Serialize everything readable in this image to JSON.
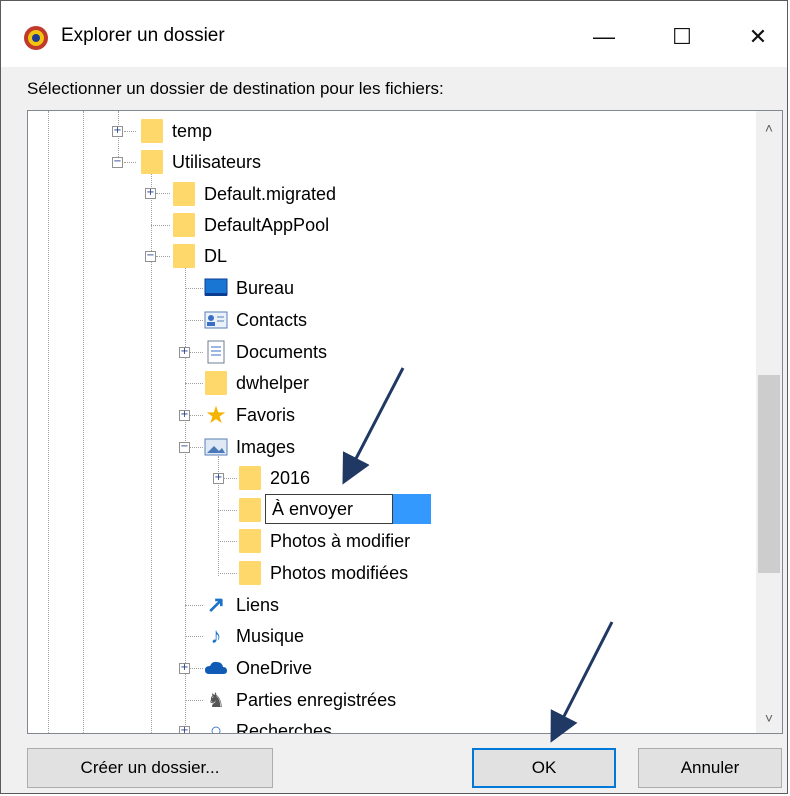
{
  "window": {
    "title": "Explorer un dossier"
  },
  "titlebar": {
    "minimize": "—",
    "maximize": "☐",
    "close": "✕"
  },
  "prompt": "Sélectionner un dossier de destination pour les fichiers:",
  "tree": {
    "items": [
      {
        "label": "temp",
        "icon": "folder-icon"
      },
      {
        "label": "Utilisateurs",
        "icon": "folder-icon"
      },
      {
        "label": "Default.migrated",
        "icon": "folder-icon"
      },
      {
        "label": "DefaultAppPool",
        "icon": "folder-icon"
      },
      {
        "label": "DL",
        "icon": "folder-icon"
      },
      {
        "label": "Bureau",
        "icon": "desktop-icon"
      },
      {
        "label": "Contacts",
        "icon": "contacts-icon"
      },
      {
        "label": "Documents",
        "icon": "documents-icon"
      },
      {
        "label": "dwhelper",
        "icon": "folder-icon"
      },
      {
        "label": "Favoris",
        "icon": "star-icon"
      },
      {
        "label": "Images",
        "icon": "images-icon"
      },
      {
        "label": "2016",
        "icon": "folder-icon"
      },
      {
        "label": "À envoyer",
        "icon": "folder-icon"
      },
      {
        "label": "Photos à modifier",
        "icon": "folder-icon"
      },
      {
        "label": "Photos modifiées",
        "icon": "folder-icon"
      },
      {
        "label": "Liens",
        "icon": "link-icon"
      },
      {
        "label": "Musique",
        "icon": "music-icon"
      },
      {
        "label": "OneDrive",
        "icon": "cloud-icon"
      },
      {
        "label": "Parties enregistrées",
        "icon": "saved-games-icon"
      },
      {
        "label": "Recherches",
        "icon": "search-icon"
      }
    ]
  },
  "buttons": {
    "create": "Créer un dossier...",
    "ok": "OK",
    "cancel": "Annuler"
  },
  "colors": {
    "folder": "#ffd86b",
    "selection": "#3399ff",
    "ok_border": "#0078d7",
    "arrow": "#1f3864"
  }
}
